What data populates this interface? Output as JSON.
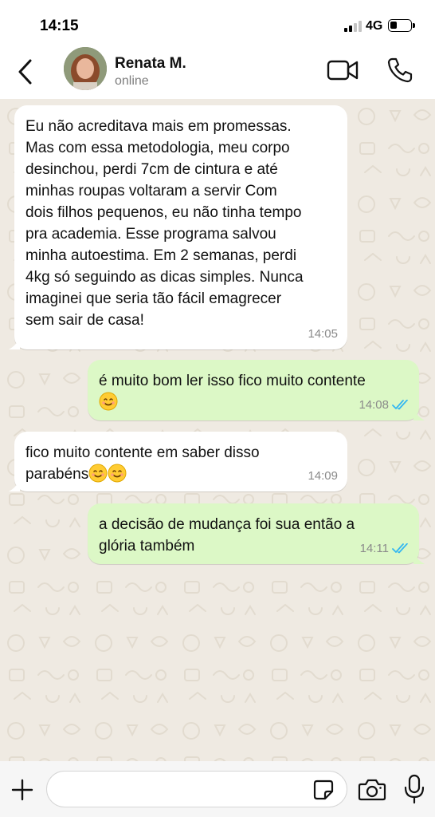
{
  "status_bar": {
    "time": "14:15",
    "network": "4G"
  },
  "header": {
    "contact_name": "Renata M.",
    "contact_status": "online"
  },
  "messages": [
    {
      "direction": "incoming",
      "text": "Eu não acreditava mais em promessas.\nMas com essa metodologia, meu corpo\ndesinchou, perdi 7cm de cintura e até\nminhas roupas voltaram a servir Com\ndois filhos pequenos, eu não tinha tempo\npra academia. Esse programa salvou\nminha autoestima. Em 2 semanas, perdi\n4kg só seguindo as dicas simples. Nunca\nimaginei que seria tão fácil emagrecer\nsem sair de casa!",
      "time": "14:05"
    },
    {
      "direction": "outgoing",
      "text": "é muito bom ler isso fico muito contente",
      "emoji": "smiling-face",
      "time": "14:08",
      "status": "read"
    },
    {
      "direction": "incoming",
      "text": "fico muito contente em saber disso\nparabéns",
      "emoji": "smiling-face x2",
      "time": "14:09"
    },
    {
      "direction": "outgoing",
      "text": "a decisão de mudança foi sua então a\nglória também",
      "time": "14:11",
      "status": "read"
    }
  ],
  "input_bar": {
    "value": "",
    "placeholder": ""
  },
  "colors": {
    "chat_background": "#efeae2",
    "incoming_bubble": "#ffffff",
    "outgoing_bubble": "#dcf8c6",
    "read_ticks": "#34b7f1",
    "timestamp": "#8a8a8a"
  },
  "icons": {
    "back": "chevron-left-icon",
    "video": "video-camera-icon",
    "call": "phone-icon",
    "plus": "plus-icon",
    "sticker": "sticker-icon",
    "camera": "camera-icon",
    "mic": "microphone-icon",
    "read": "double-check-icon"
  }
}
